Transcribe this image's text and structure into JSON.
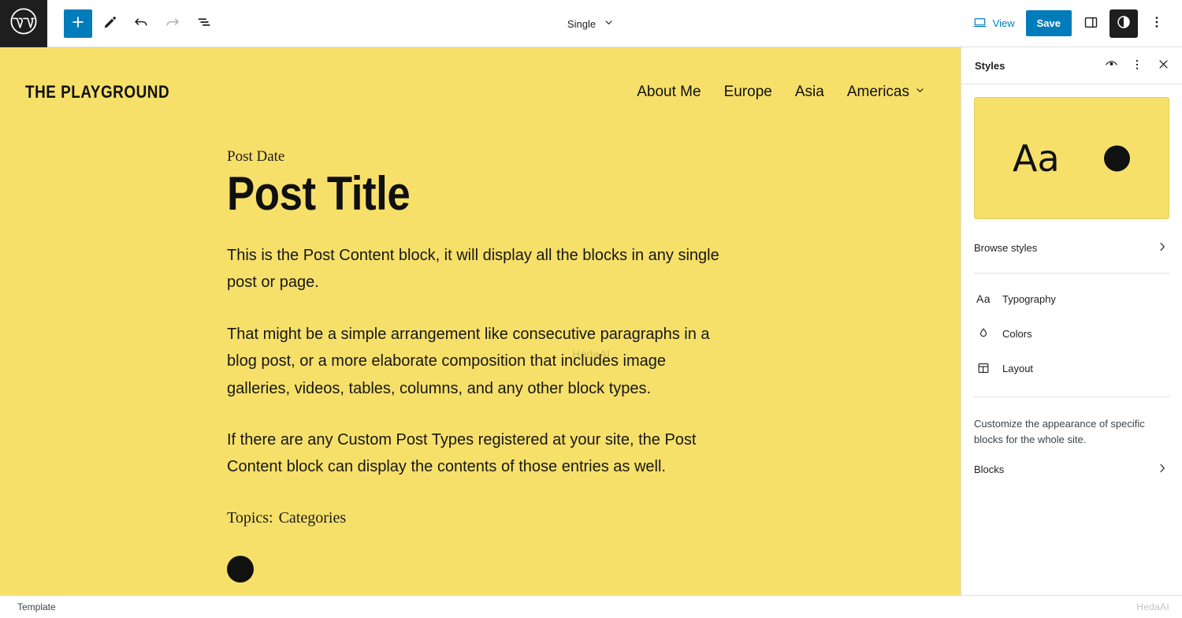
{
  "topbar": {
    "logo_icon": "wordpress-logo",
    "add_block_label": "+",
    "tools": [
      {
        "name": "add-block",
        "icon": "plus-icon"
      },
      {
        "name": "edit-tool",
        "icon": "pencil-icon"
      },
      {
        "name": "undo",
        "icon": "undo-arrow-icon"
      },
      {
        "name": "redo",
        "icon": "redo-arrow-icon"
      },
      {
        "name": "list-view",
        "icon": "document-overview-icon"
      }
    ],
    "document_title": "Single",
    "view_label": "View",
    "save_label": "Save",
    "accent_blue": "#007cba"
  },
  "canvas": {
    "background_color": "#f6e06a",
    "site_title": "THE PLAYGROUND",
    "nav": [
      {
        "label": "About Me",
        "has_submenu": false
      },
      {
        "label": "Europe",
        "has_submenu": false
      },
      {
        "label": "Asia",
        "has_submenu": false
      },
      {
        "label": "Americas",
        "has_submenu": true
      }
    ],
    "post": {
      "date": "Post Date",
      "title": "Post Title",
      "paragraphs": [
        "This is the Post Content block, it will display all the blocks in any single post or page.",
        "That might be a simple arrangement like consecutive paragraphs in a blog post, or a more elaborate composition that includes image galleries, videos, tables, columns, and any other block types.",
        "If there are any Custom Post Types registered at your site, the Post Content block can display the contents of those entries as well."
      ],
      "topics_label": "Topics:",
      "topics_value": "Categories"
    },
    "watermark": "HedaAI"
  },
  "sidebar": {
    "title": "Styles",
    "header_actions": [
      {
        "name": "style-book",
        "icon": "eye-icon"
      },
      {
        "name": "styles-options",
        "icon": "more-vertical-icon"
      },
      {
        "name": "close-styles",
        "icon": "close-icon"
      }
    ],
    "preview": {
      "sample_text": "Aa",
      "background_color": "#f6e06a",
      "swatch_color": "#111111"
    },
    "browse_styles": "Browse styles",
    "menu": [
      {
        "label": "Typography",
        "icon": "typography-aa-icon"
      },
      {
        "label": "Colors",
        "icon": "color-droplet-icon"
      },
      {
        "label": "Layout",
        "icon": "layout-grid-icon"
      }
    ],
    "help_text": "Customize the appearance of specific blocks for the whole site.",
    "blocks_label": "Blocks"
  },
  "footer": {
    "status": "Template",
    "watermark": "HedaAI"
  }
}
